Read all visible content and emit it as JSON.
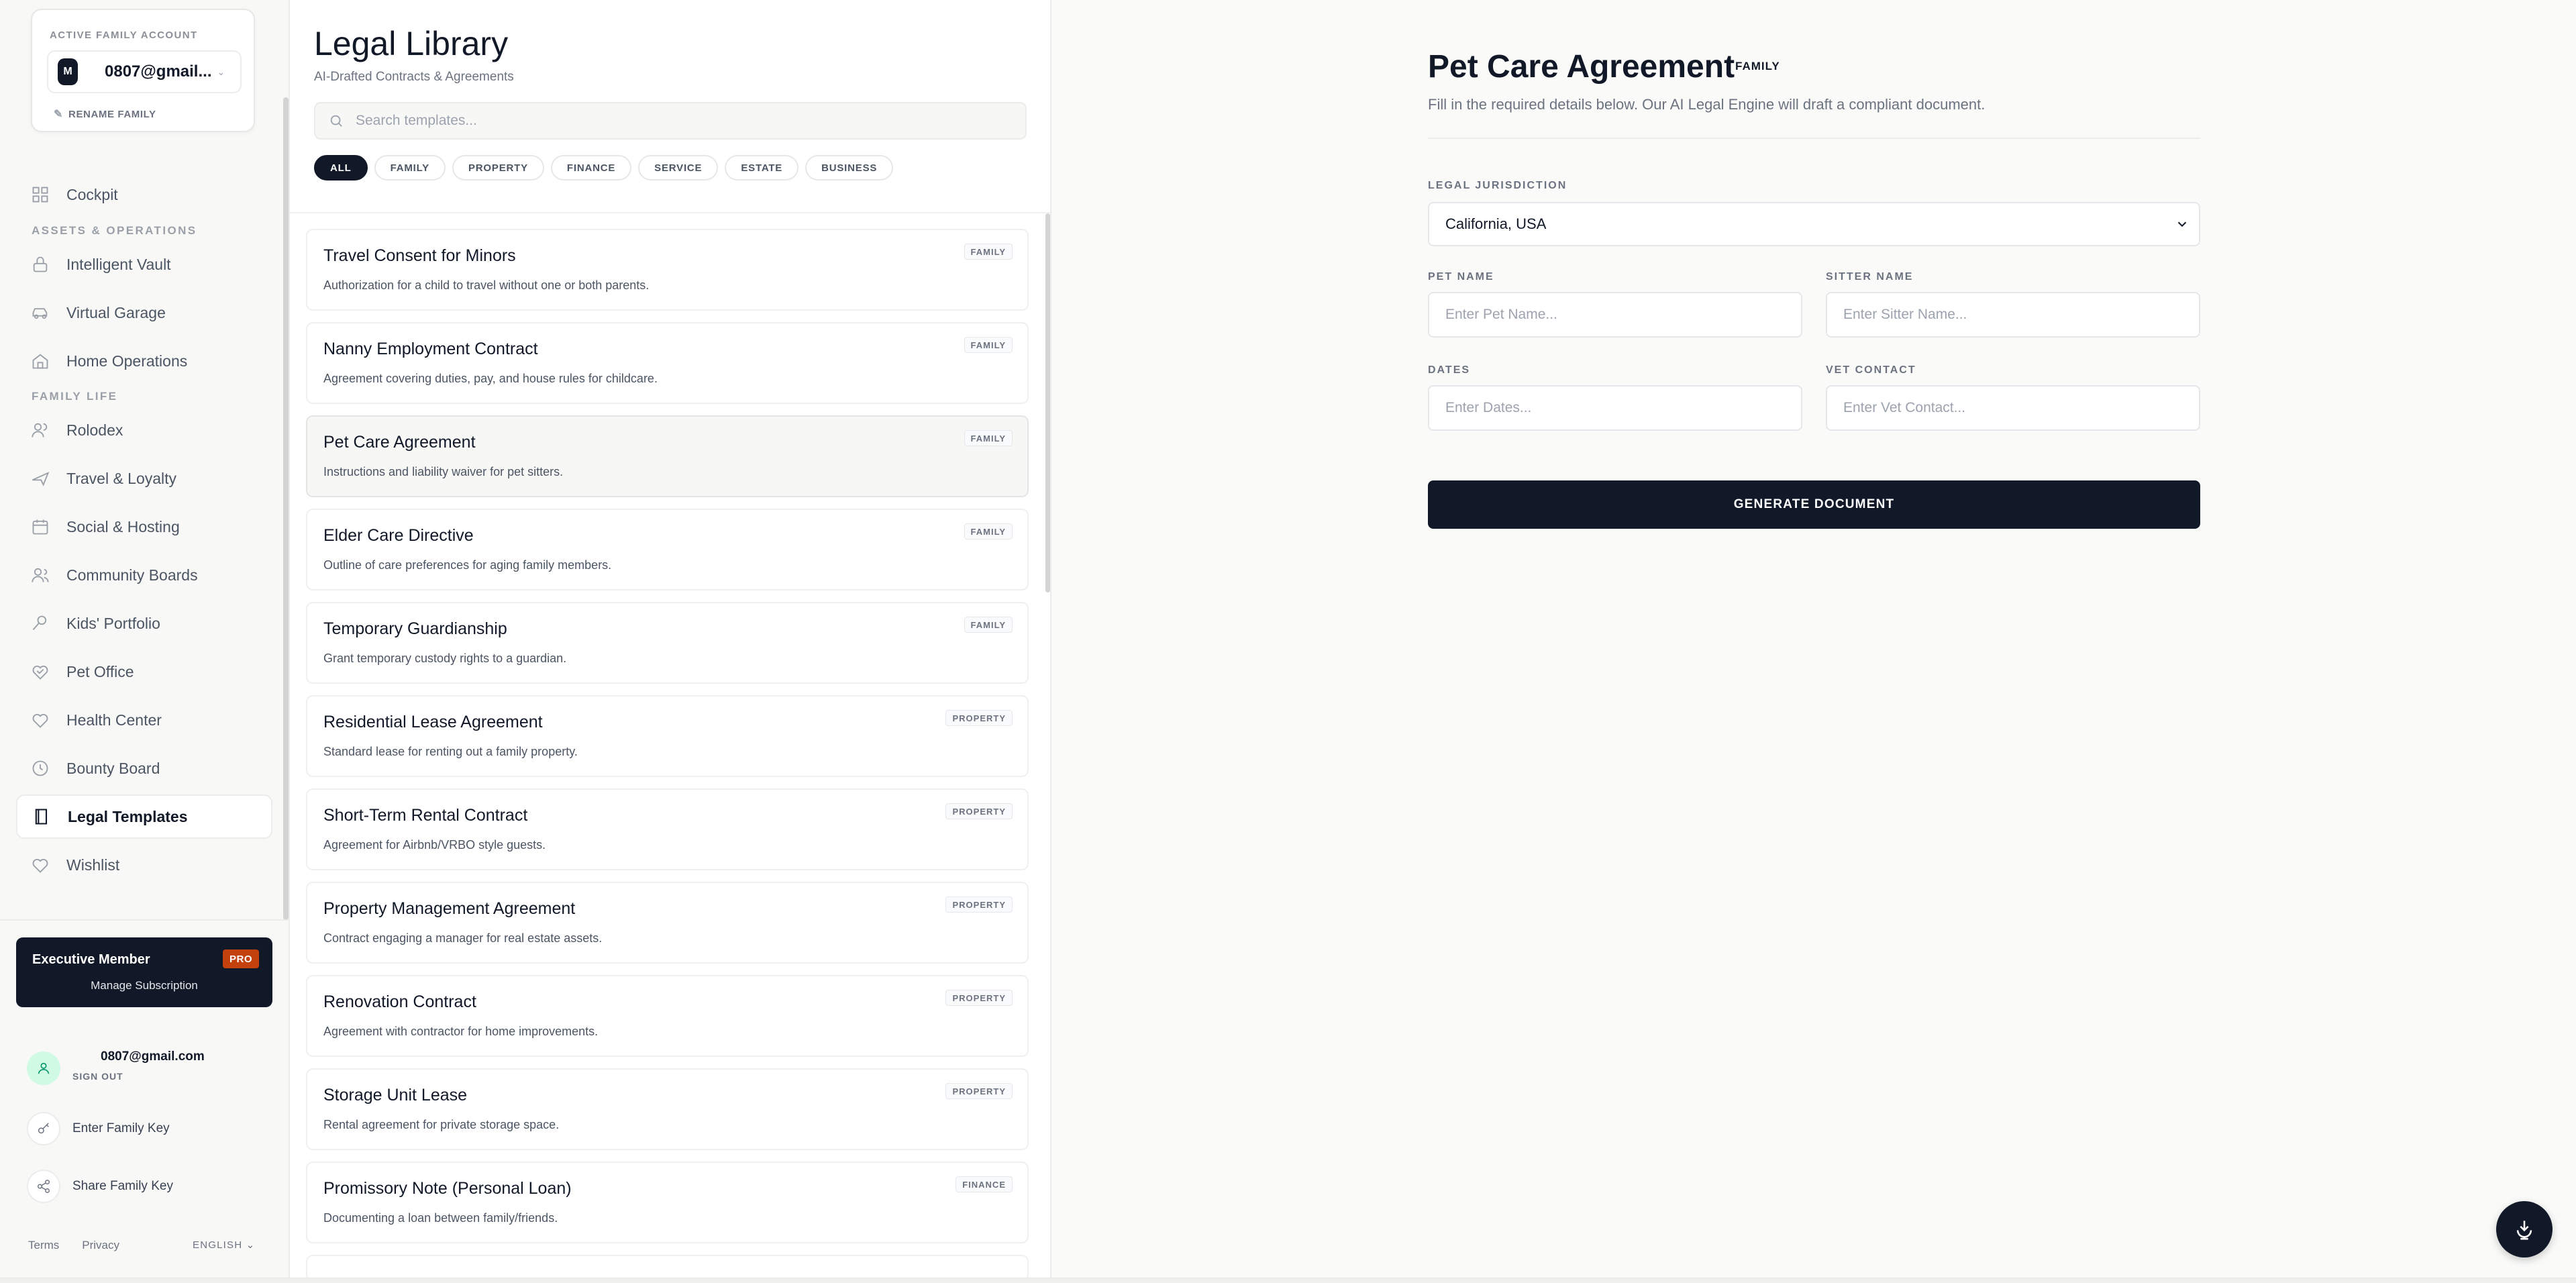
{
  "account": {
    "label": "ACTIVE FAMILY ACCOUNT",
    "avatar_letter": "M",
    "name": "0807@gmail...",
    "rename_label": "RENAME FAMILY"
  },
  "nav": {
    "cockpit": "Cockpit",
    "section_assets": "ASSETS & OPERATIONS",
    "vault": "Intelligent Vault",
    "garage": "Virtual Garage",
    "home": "Home Operations",
    "section_family": "FAMILY LIFE",
    "rolodex": "Rolodex",
    "travel": "Travel & Loyalty",
    "social": "Social & Hosting",
    "community": "Community Boards",
    "kids": "Kids' Portfolio",
    "pet": "Pet Office",
    "health": "Health Center",
    "bounty": "Bounty Board",
    "legal": "Legal Templates",
    "wishlist": "Wishlist"
  },
  "membership": {
    "title": "Executive Member",
    "badge": "PRO",
    "manage": "Manage Subscription"
  },
  "user": {
    "email": "0807@gmail.com",
    "sign_out": "SIGN OUT",
    "enter_key": "Enter Family Key",
    "share_key": "Share Family Key"
  },
  "footer": {
    "terms": "Terms",
    "privacy": "Privacy",
    "language": "ENGLISH"
  },
  "library": {
    "title": "Legal Library",
    "subtitle": "AI-Drafted Contracts & Agreements",
    "search_placeholder": "Search templates...",
    "filters": [
      "ALL",
      "FAMILY",
      "PROPERTY",
      "FINANCE",
      "SERVICE",
      "ESTATE",
      "BUSINESS"
    ],
    "active_filter": "ALL",
    "templates": [
      {
        "name": "Travel Consent for Minors",
        "desc": "Authorization for a child to travel without one or both parents.",
        "tag": "FAMILY"
      },
      {
        "name": "Nanny Employment Contract",
        "desc": "Agreement covering duties, pay, and house rules for childcare.",
        "tag": "FAMILY"
      },
      {
        "name": "Pet Care Agreement",
        "desc": "Instructions and liability waiver for pet sitters.",
        "tag": "FAMILY"
      },
      {
        "name": "Elder Care Directive",
        "desc": "Outline of care preferences for aging family members.",
        "tag": "FAMILY"
      },
      {
        "name": "Temporary Guardianship",
        "desc": "Grant temporary custody rights to a guardian.",
        "tag": "FAMILY"
      },
      {
        "name": "Residential Lease Agreement",
        "desc": "Standard lease for renting out a family property.",
        "tag": "PROPERTY"
      },
      {
        "name": "Short-Term Rental Contract",
        "desc": "Agreement for Airbnb/VRBO style guests.",
        "tag": "PROPERTY"
      },
      {
        "name": "Property Management Agreement",
        "desc": "Contract engaging a manager for real estate assets.",
        "tag": "PROPERTY"
      },
      {
        "name": "Renovation Contract",
        "desc": "Agreement with contractor for home improvements.",
        "tag": "PROPERTY"
      },
      {
        "name": "Storage Unit Lease",
        "desc": "Rental agreement for private storage space.",
        "tag": "PROPERTY"
      },
      {
        "name": "Promissory Note (Personal Loan)",
        "desc": "Documenting a loan between family/friends.",
        "tag": "FINANCE"
      }
    ]
  },
  "form": {
    "title": "Pet Care Agreement",
    "badge": "FAMILY",
    "subtitle": "Fill in the required details below. Our AI Legal Engine will draft a compliant document.",
    "jurisdiction_label": "LEGAL JURISDICTION",
    "jurisdiction_value": "California, USA",
    "pet_name_label": "PET NAME",
    "pet_name_placeholder": "Enter Pet Name...",
    "sitter_name_label": "SITTER NAME",
    "sitter_name_placeholder": "Enter Sitter Name...",
    "dates_label": "DATES",
    "dates_placeholder": "Enter Dates...",
    "vet_label": "VET CONTACT",
    "vet_placeholder": "Enter Vet Contact...",
    "generate_label": "GENERATE DOCUMENT"
  }
}
